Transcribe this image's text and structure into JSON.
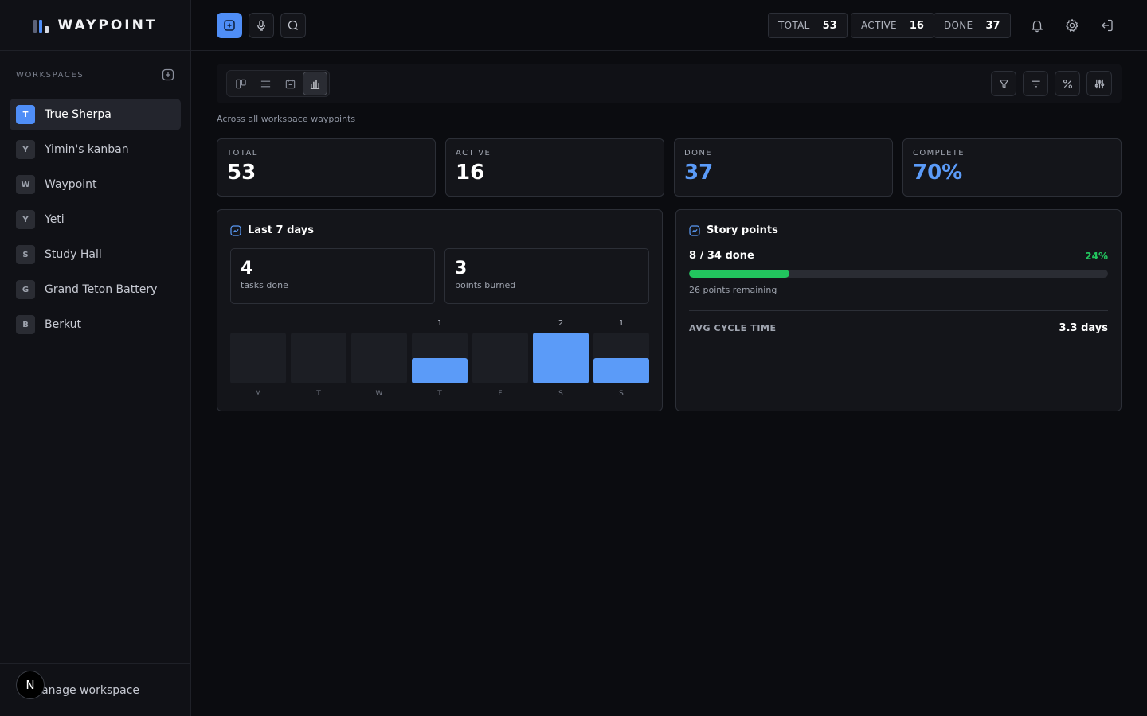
{
  "brand": {
    "name": "WAYPOINT"
  },
  "sidebar": {
    "section_title": "WORKSPACES",
    "items": [
      {
        "badge": "T",
        "label": "True Sherpa",
        "active": true
      },
      {
        "badge": "Y",
        "label": "Yimin's kanban",
        "active": false
      },
      {
        "badge": "W",
        "label": "Waypoint",
        "active": false
      },
      {
        "badge": "Y",
        "label": "Yeti",
        "active": false
      },
      {
        "badge": "S",
        "label": "Study Hall",
        "active": false
      },
      {
        "badge": "G",
        "label": "Grand Teton Battery",
        "active": false
      },
      {
        "badge": "B",
        "label": "Berkut",
        "active": false
      }
    ],
    "footer_label": "Manage workspace",
    "avatar_letter": "N"
  },
  "topbar": {
    "stats": [
      {
        "label": "TOTAL",
        "value": "53"
      },
      {
        "label": "ACTIVE",
        "value": "16"
      },
      {
        "label": "DONE",
        "value": "37"
      }
    ]
  },
  "content": {
    "subtitle": "Across all workspace waypoints",
    "kpis": [
      {
        "label": "TOTAL",
        "value": "53"
      },
      {
        "label": "ACTIVE",
        "value": "16"
      },
      {
        "label": "DONE",
        "value": "37"
      },
      {
        "label": "COMPLETE",
        "value": "70%"
      }
    ],
    "last7": {
      "title": "Last 7 days",
      "tasks_done_value": "4",
      "tasks_done_label": "tasks done",
      "points_burned_value": "3",
      "points_burned_label": "points burned"
    },
    "story_points": {
      "title": "Story points",
      "done_text": "8 / 34 done",
      "percent_text": "24%",
      "progress": 0.24,
      "remaining": "26 points remaining",
      "avg_cycle_label": "AVG CYCLE TIME",
      "avg_cycle_value": "3.3 days"
    }
  },
  "chart_data": {
    "type": "bar",
    "categories": [
      "M",
      "T",
      "W",
      "T",
      "F",
      "S",
      "S"
    ],
    "values": [
      0,
      0,
      0,
      1,
      0,
      2,
      1
    ],
    "ylim": [
      0,
      2
    ],
    "colors": {
      "bar": "#5b9bf8",
      "empty": "#1c1e24"
    }
  },
  "colors": {
    "accent": "#4f8ef7",
    "success": "#22c55e"
  }
}
